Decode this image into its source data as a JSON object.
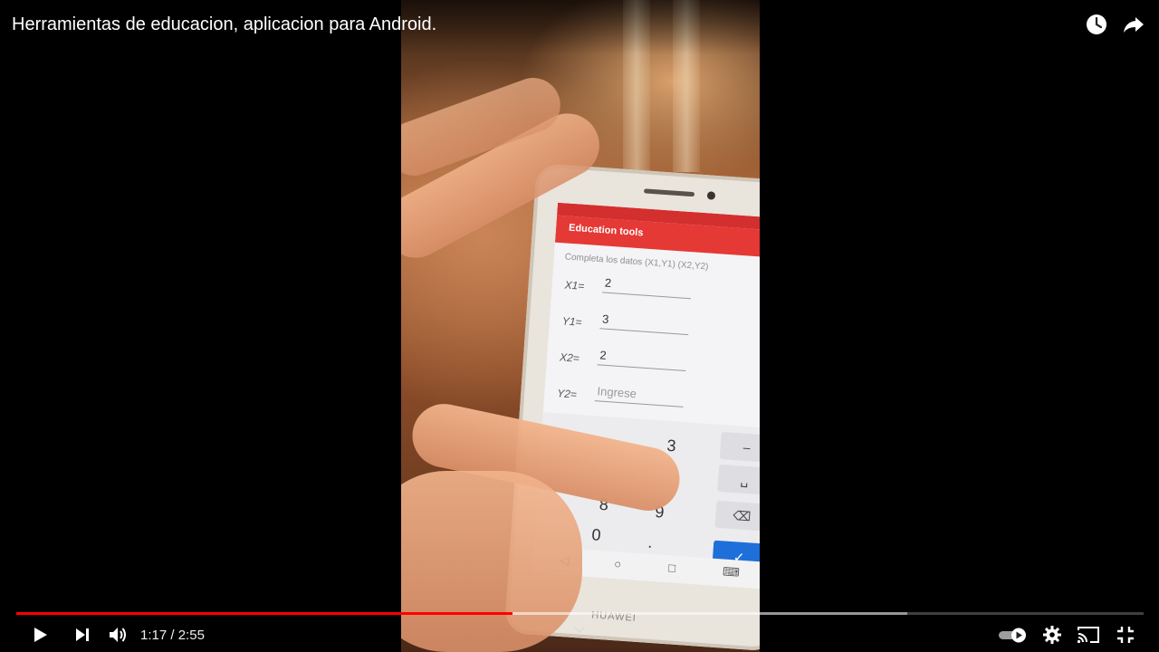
{
  "video": {
    "title": "Herramientas de educacion, aplicacion para Android.",
    "current_time": "1:17",
    "separator": "/",
    "duration": "2:55",
    "played_fraction": 0.44,
    "buffered_fraction": 0.79
  },
  "phone": {
    "brand": "HUAWEI",
    "app_title": "Education tools",
    "subtitle": "Completa los datos (X1,Y1) (X2,Y2)",
    "fields": [
      {
        "label": "X1=",
        "value": "2",
        "placeholder": ""
      },
      {
        "label": "Y1=",
        "value": "3",
        "placeholder": ""
      },
      {
        "label": "X2=",
        "value": "2",
        "placeholder": ""
      },
      {
        "label": "Y2=",
        "value": "",
        "placeholder": "Ingrese"
      }
    ],
    "keys": {
      "k3": "3",
      "k8": "8",
      "k9": "9",
      "k0": "0",
      "dot": ".",
      "minus": "–",
      "space": "␣",
      "backspace": "⌫",
      "done": "✓"
    }
  },
  "icons": {
    "watch_later": "clock-icon",
    "share": "share-icon",
    "play": "play-icon",
    "next": "next-icon",
    "volume": "volume-icon",
    "autoplay": "autoplay-toggle",
    "settings": "gear-icon",
    "cast": "cast-icon",
    "exit_fullscreen": "exit-fullscreen-icon"
  },
  "colors": {
    "progress": "#ff0000",
    "app_bar": "#e53935",
    "done_key": "#1e6fd9"
  }
}
